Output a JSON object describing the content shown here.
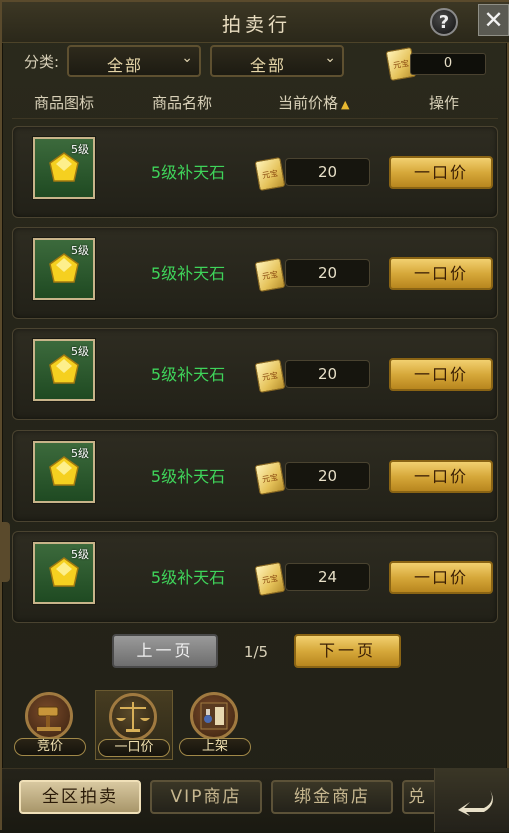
{
  "title": "拍卖行",
  "help_label": "?",
  "close_label": "✕",
  "filter": {
    "label": "分类:",
    "category1": "全部",
    "category2": "全部",
    "arrow": "⌄"
  },
  "balance": {
    "currency_text": "元宝",
    "value": "0"
  },
  "headers": {
    "icon": "商品图标",
    "name": "商品名称",
    "price": "当前价格",
    "sort_indicator": "▲",
    "action": "操作"
  },
  "items": [
    {
      "level": "5级",
      "name": "5级补天石",
      "price": "20",
      "buy_label": "一口价"
    },
    {
      "level": "5级",
      "name": "5级补天石",
      "price": "20",
      "buy_label": "一口价"
    },
    {
      "level": "5级",
      "name": "5级补天石",
      "price": "20",
      "buy_label": "一口价"
    },
    {
      "level": "5级",
      "name": "5级补天石",
      "price": "20",
      "buy_label": "一口价"
    },
    {
      "level": "5级",
      "name": "5级补天石",
      "price": "24",
      "buy_label": "一口价"
    }
  ],
  "pagination": {
    "prev": "上一页",
    "current": "1/5",
    "next": "下一页"
  },
  "modes": [
    {
      "label": "竞价",
      "icon": "gavel-icon"
    },
    {
      "label": "一口价",
      "icon": "scales-icon"
    },
    {
      "label": "上架",
      "icon": "shelf-icon"
    }
  ],
  "tabs": [
    {
      "label": "全区拍卖",
      "active": true
    },
    {
      "label": "VIP商店",
      "active": false
    },
    {
      "label": "绑金商店",
      "active": false
    },
    {
      "label": "兑",
      "active": false
    }
  ],
  "colors": {
    "item_name": "#3fd45a",
    "gold_button": "#d6a83a",
    "gem": "#f5d020"
  }
}
